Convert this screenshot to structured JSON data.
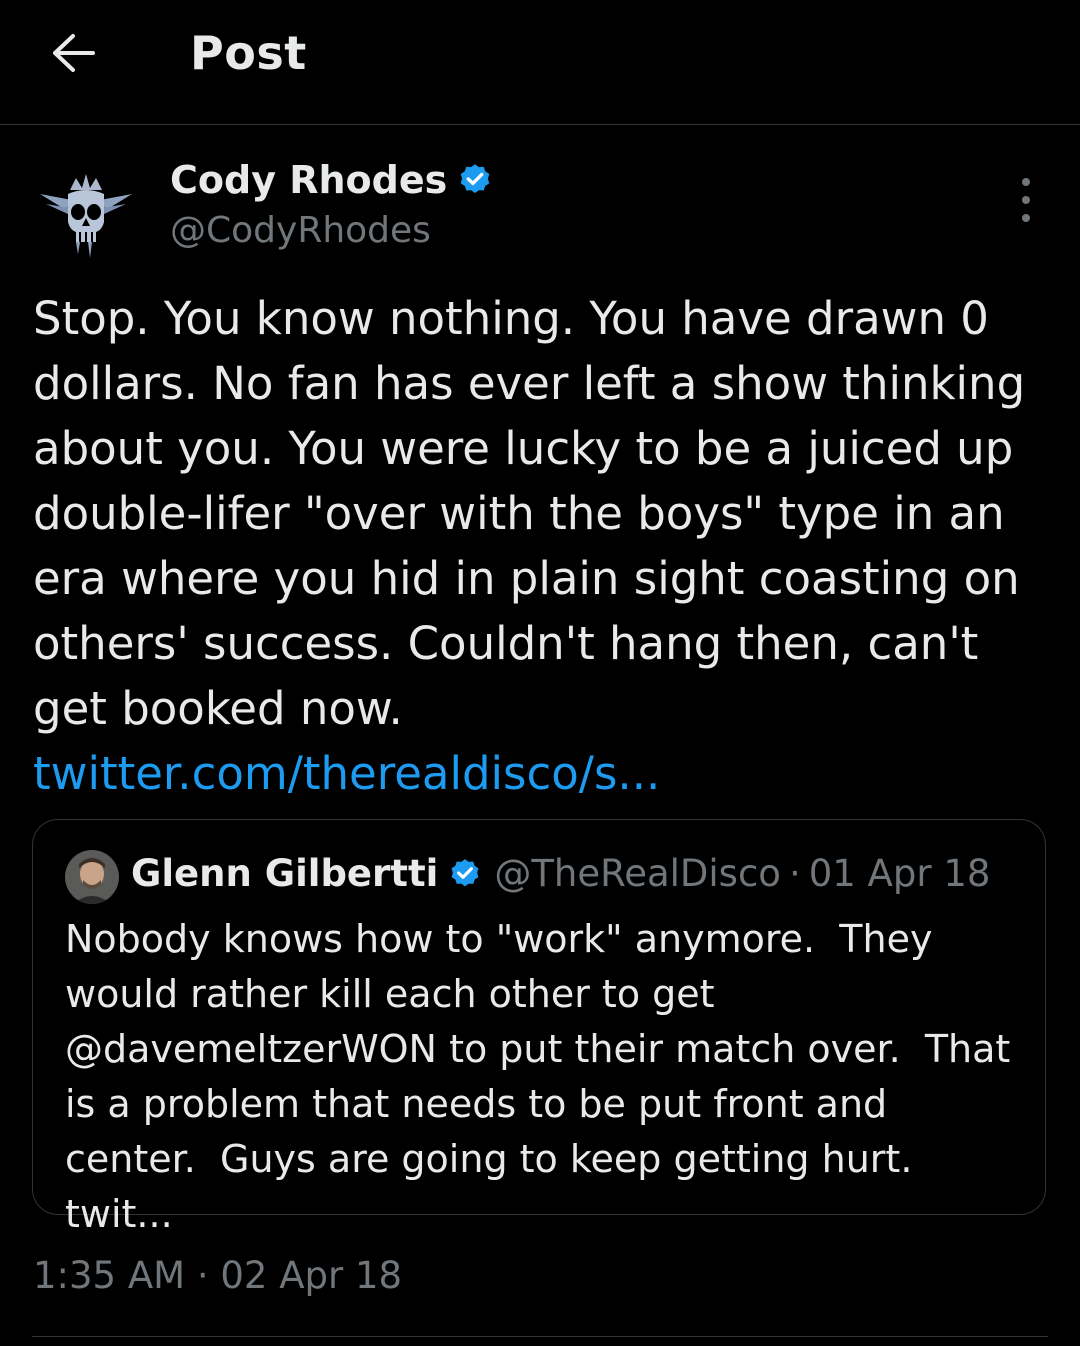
{
  "header": {
    "title": "Post",
    "back_icon": "arrow-left-icon"
  },
  "tweet": {
    "author_name": "Cody Rhodes",
    "author_handle": "@CodyRhodes",
    "verified_color": "#1d9bf0",
    "text": "Stop. You know nothing. You have drawn 0 dollars. No fan has ever left a show thinking about you. You were lucky to be a juiced up double-lifer \"over with the boys\" type in an era where you hid in plain sight coasting on others' success. Couldn't hang then, can't get booked now. ",
    "link_text": "twitter.com/therealdisco/s...",
    "link_color": "#1d9bf0",
    "timestamp": "1:35 AM · 02 Apr 18"
  },
  "quoted_tweet": {
    "author_name": "Glenn Gilbertti",
    "author_handle": "@TheRealDisco",
    "date": "01 Apr 18",
    "separator": "·",
    "text": "Nobody knows how to \"work\" anymore.  They would rather kill each other to get @davemeltzerWON to put their match over.  That is a problem that needs to be put front and center.  Guys are going to keep getting hurt. twit..."
  },
  "colors": {
    "background": "#000000",
    "text": "#e7e9ea",
    "secondary_text": "#71767b",
    "border": "#2f3336",
    "accent": "#1d9bf0"
  }
}
